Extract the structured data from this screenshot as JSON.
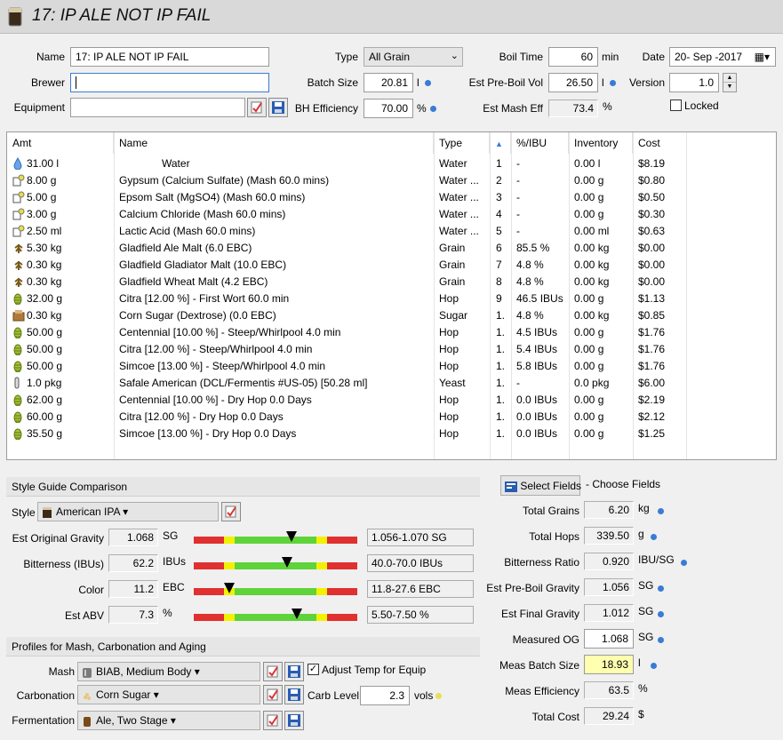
{
  "title": "17: IP ALE NOT IP FAIL",
  "form": {
    "name_label": "Name",
    "name_value": "17: IP ALE NOT IP FAIL",
    "brewer_label": "Brewer",
    "brewer_value": "",
    "equipment_label": "Equipment",
    "equipment_value": "",
    "type_label": "Type",
    "type_value": "All Grain",
    "batch_label": "Batch Size",
    "batch_value": "20.81",
    "batch_unit": "l",
    "bh_label": "BH Efficiency",
    "bh_value": "70.00",
    "bh_unit": "%",
    "boil_label": "Boil Time",
    "boil_value": "60",
    "boil_unit": "min",
    "preboil_label": "Est Pre-Boil Vol",
    "preboil_value": "26.50",
    "preboil_unit": "l",
    "mash_eff_label": "Est Mash Eff",
    "mash_eff_value": "73.4",
    "mash_eff_unit": "%",
    "date_label": "Date",
    "date_value": "20- Sep -2017",
    "version_label": "Version",
    "version_value": "1.0",
    "locked_label": "Locked"
  },
  "grid": {
    "headers": [
      "Amt",
      "Name",
      "Type",
      "",
      "%/IBU",
      "Inventory",
      "Cost"
    ],
    "rows": [
      {
        "icon": "water",
        "amt": "31.00 l",
        "name": "Water",
        "type": "Water",
        "num": "1",
        "pct": "-",
        "inv": "0.00 l",
        "cost": "$8.19",
        "indent": true
      },
      {
        "icon": "misc",
        "amt": "8.00 g",
        "name": "Gypsum (Calcium Sulfate) (Mash 60.0 mins)",
        "type": "Water ...",
        "num": "2",
        "pct": "-",
        "inv": "0.00 g",
        "cost": "$0.80"
      },
      {
        "icon": "misc",
        "amt": "5.00 g",
        "name": "Epsom Salt (MgSO4) (Mash 60.0 mins)",
        "type": "Water ...",
        "num": "3",
        "pct": "-",
        "inv": "0.00 g",
        "cost": "$0.50"
      },
      {
        "icon": "misc",
        "amt": "3.00 g",
        "name": "Calcium Chloride (Mash 60.0 mins)",
        "type": "Water ...",
        "num": "4",
        "pct": "-",
        "inv": "0.00 g",
        "cost": "$0.30"
      },
      {
        "icon": "misc",
        "amt": "2.50 ml",
        "name": "Lactic Acid (Mash 60.0 mins)",
        "type": "Water ...",
        "num": "5",
        "pct": "-",
        "inv": "0.00 ml",
        "cost": "$0.63"
      },
      {
        "icon": "grain",
        "amt": "5.30 kg",
        "name": "Gladfield Ale Malt (6.0 EBC)",
        "type": "Grain",
        "num": "6",
        "pct": "85.5 %",
        "inv": "0.00 kg",
        "cost": "$0.00"
      },
      {
        "icon": "grain",
        "amt": "0.30 kg",
        "name": "Gladfield Gladiator Malt (10.0 EBC)",
        "type": "Grain",
        "num": "7",
        "pct": "4.8 %",
        "inv": "0.00 kg",
        "cost": "$0.00"
      },
      {
        "icon": "grain",
        "amt": "0.30 kg",
        "name": "Gladfield Wheat Malt (4.2 EBC)",
        "type": "Grain",
        "num": "8",
        "pct": "4.8 %",
        "inv": "0.00 kg",
        "cost": "$0.00"
      },
      {
        "icon": "hop",
        "amt": "32.00 g",
        "name": "Citra [12.00 %] - First Wort 60.0 min",
        "type": "Hop",
        "num": "9",
        "pct": "46.5 IBUs",
        "inv": "0.00 g",
        "cost": "$1.13"
      },
      {
        "icon": "sugar",
        "amt": "0.30 kg",
        "name": "Corn Sugar (Dextrose) (0.0 EBC)",
        "type": "Sugar",
        "num": "1.",
        "pct": "4.8 %",
        "inv": "0.00 kg",
        "cost": "$0.85"
      },
      {
        "icon": "hop",
        "amt": "50.00 g",
        "name": "Centennial [10.00 %] - Steep/Whirlpool  4.0 min",
        "type": "Hop",
        "num": "1.",
        "pct": "4.5 IBUs",
        "inv": "0.00 g",
        "cost": "$1.76"
      },
      {
        "icon": "hop",
        "amt": "50.00 g",
        "name": "Citra [12.00 %] - Steep/Whirlpool  4.0 min",
        "type": "Hop",
        "num": "1.",
        "pct": "5.4 IBUs",
        "inv": "0.00 g",
        "cost": "$1.76"
      },
      {
        "icon": "hop",
        "amt": "50.00 g",
        "name": "Simcoe [13.00 %] - Steep/Whirlpool  4.0 min",
        "type": "Hop",
        "num": "1.",
        "pct": "5.8 IBUs",
        "inv": "0.00 g",
        "cost": "$1.76"
      },
      {
        "icon": "yeast",
        "amt": "1.0 pkg",
        "name": "Safale American  (DCL/Fermentis #US-05) [50.28 ml]",
        "type": "Yeast",
        "num": "1.",
        "pct": "-",
        "inv": "0.0 pkg",
        "cost": "$6.00"
      },
      {
        "icon": "hop",
        "amt": "62.00 g",
        "name": "Centennial [10.00 %] - Dry Hop 0.0 Days",
        "type": "Hop",
        "num": "1.",
        "pct": "0.0 IBUs",
        "inv": "0.00 g",
        "cost": "$2.19"
      },
      {
        "icon": "hop",
        "amt": "60.00 g",
        "name": "Citra [12.00 %] - Dry Hop 0.0 Days",
        "type": "Hop",
        "num": "1.",
        "pct": "0.0 IBUs",
        "inv": "0.00 g",
        "cost": "$2.12"
      },
      {
        "icon": "hop",
        "amt": "35.50 g",
        "name": "Simcoe [13.00 %] - Dry Hop 0.0 Days",
        "type": "Hop",
        "num": "1.",
        "pct": "0.0 IBUs",
        "inv": "0.00 g",
        "cost": "$1.25"
      }
    ]
  },
  "style": {
    "section_title": "Style Guide Comparison",
    "style_label": "Style",
    "style_value": "American IPA",
    "rows": [
      {
        "label": "Est Original Gravity",
        "value": "1.068",
        "unit": "SG",
        "range": "1.056-1.070 SG",
        "marker": 0.6
      },
      {
        "label": "Bitterness (IBUs)",
        "value": "62.2",
        "unit": "IBUs",
        "range": "40.0-70.0 IBUs",
        "marker": 0.57
      },
      {
        "label": "Color",
        "value": "11.2",
        "unit": "EBC",
        "range": "11.8-27.6 EBC",
        "marker": 0.22
      },
      {
        "label": "Est ABV",
        "value": "7.3",
        "unit": "%",
        "range": "5.50-7.50 %",
        "marker": 0.63
      }
    ]
  },
  "profiles": {
    "section_title": "Profiles for Mash, Carbonation and Aging",
    "mash_label": "Mash",
    "mash_value": "BIAB, Medium Body",
    "carb_label": "Carbonation",
    "carb_value": "Corn Sugar",
    "ferm_label": "Fermentation",
    "ferm_value": "Ale, Two Stage",
    "adjust_label": "Adjust Temp for Equip",
    "carb_level_label": "Carb Level",
    "carb_level_value": "2.3",
    "carb_level_unit": "vols"
  },
  "stats": {
    "select_fields_label": "Select Fields",
    "choose_fields_label": "- Choose Fields",
    "rows": [
      {
        "label": "Total Grains",
        "value": "6.20",
        "unit": "kg",
        "dot": true
      },
      {
        "label": "Total Hops",
        "value": "339.50",
        "unit": "g",
        "dot": true
      },
      {
        "label": "Bitterness Ratio",
        "value": "0.920",
        "unit": "IBU/SG",
        "dot": true
      },
      {
        "label": "Est Pre-Boil Gravity",
        "value": "1.056",
        "unit": "SG",
        "dot": true
      },
      {
        "label": "Est Final Gravity",
        "value": "1.012",
        "unit": "SG",
        "dot": true
      },
      {
        "label": "Measured OG",
        "value": "1.068",
        "unit": "SG",
        "dot": true,
        "editable": true
      },
      {
        "label": "Meas Batch Size",
        "value": "18.93",
        "unit": "l",
        "dot": true,
        "editable": true,
        "highlight": true
      },
      {
        "label": "Meas Efficiency",
        "value": "63.5",
        "unit": "%",
        "dot": false
      },
      {
        "label": "Total Cost",
        "value": "29.24",
        "unit": "$",
        "dot": false
      }
    ]
  },
  "colors": {
    "accent": "#3a7bd5",
    "highlight": "#ffffb0",
    "bar_red": "#e03030",
    "bar_yellow": "#f2f200",
    "bar_green": "#5fd33a"
  }
}
